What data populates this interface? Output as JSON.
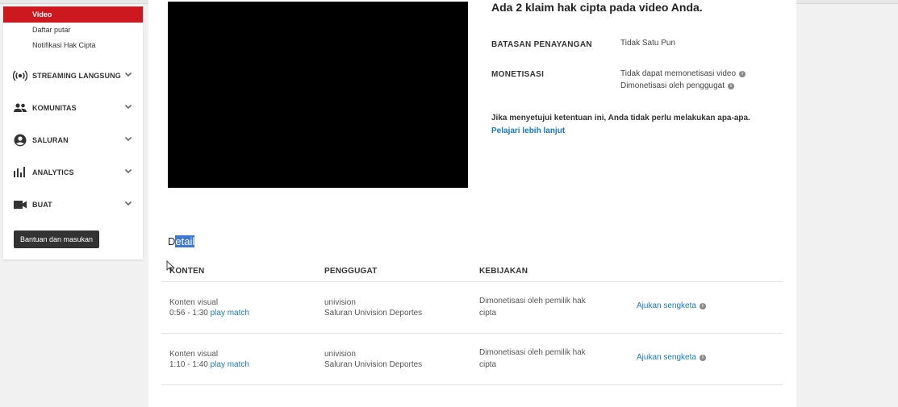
{
  "sidebar": {
    "sub_items": [
      "Video",
      "Daftar putar",
      "Notifikasi Hak Cipta"
    ],
    "nav": [
      {
        "label": "STREAMING LANGSUNG",
        "icon": "live-broadcast-icon"
      },
      {
        "label": "KOMUNITAS",
        "icon": "people-icon"
      },
      {
        "label": "SALURAN",
        "icon": "account-circle-icon"
      },
      {
        "label": "ANALYTICS",
        "icon": "bar-chart-icon"
      },
      {
        "label": "BUAT",
        "icon": "video-camera-icon"
      }
    ],
    "help_button": "Bantuan dan masukan"
  },
  "claim": {
    "title": "Ada 2 klaim hak cipta pada video Anda.",
    "restriction_label": "BATASAN PENAYANGAN",
    "restriction_value": "Tidak Satu Pun",
    "monetization_label": "MONETISASI",
    "monetization_values": [
      "Tidak dapat memonetisasi video",
      "Dimonetisasi oleh penggugat"
    ],
    "note": "Jika menyetujui ketentuan ini, Anda tidak perlu melakukan apa-apa.",
    "learn_more": "Pelajari lebih lanjut"
  },
  "detail": {
    "title_first": "D",
    "title_rest": "etail",
    "columns": [
      "KONTEN",
      "PENGGUGAT",
      "KEBIJAKAN"
    ],
    "rows": [
      {
        "content_type": "Konten visual",
        "time": "0:56 - 1:30",
        "match_link": "play match",
        "claimant": "univision",
        "channel": "Saluran Univision Deportes",
        "policy_line1": "Dimonetisasi oleh pemilik hak",
        "policy_line2": "cipta",
        "action": "Ajukan sengketa"
      },
      {
        "content_type": "Konten visual",
        "time": "1:10 - 1:40",
        "match_link": "play match",
        "claimant": "univision",
        "channel": "Saluran Univision Deportes",
        "policy_line1": "Dimonetisasi oleh pemilik hak",
        "policy_line2": "cipta",
        "action": "Ajukan sengketa"
      }
    ]
  },
  "colors": {
    "accent_red": "#cc181e",
    "link_blue": "#167ac6",
    "selection_blue": "#3b78d6"
  }
}
